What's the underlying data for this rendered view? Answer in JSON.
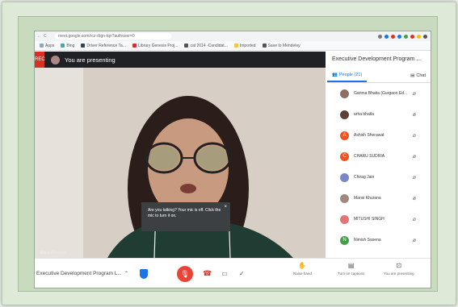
{
  "browser": {
    "url": "meet.google.com/rcz-rbgn-tqn?authuser=0",
    "bookmarks": [
      {
        "label": "Apps"
      },
      {
        "label": "Bing"
      },
      {
        "label": "Driver Reference Ta..."
      },
      {
        "label": "Library Genesis Proj..."
      },
      {
        "label": "cat 2014 -Candidat..."
      },
      {
        "label": "Imported"
      },
      {
        "label": "Save to Mendeley"
      }
    ]
  },
  "meet": {
    "rec_label": "REC",
    "presenting_text": "You are presenting",
    "speaker_name": "Manu Khurana",
    "tooltip_text": "Are you talking? Your mic is off. Click the mic to turn it on.",
    "panel_title": "Executive Development Program ...",
    "people_tab": "People (21)",
    "chat_tab": "Chat",
    "participants": [
      {
        "name": "Garima Bhatia (Gurgaon Ed...",
        "color": "#8d6e63",
        "initial": ""
      },
      {
        "name": "arha bhatla",
        "color": "#5d4037",
        "initial": ""
      },
      {
        "name": "Ashish Sherawat",
        "color": "#f4511e",
        "initial": "A"
      },
      {
        "name": "CHARU SUDRIA",
        "color": "#f4511e",
        "initial": "C"
      },
      {
        "name": "Chirag Jain",
        "color": "#7986cb",
        "initial": ""
      },
      {
        "name": "Mansi Khurana",
        "color": "#a1887f",
        "initial": ""
      },
      {
        "name": "MITUSHI SINGH",
        "color": "#e57373",
        "initial": ""
      },
      {
        "name": "Nimish Saxena",
        "color": "#43a047",
        "initial": "N"
      }
    ],
    "meeting_name": "Executive Development Program L...",
    "actions": {
      "raise_hand": "Raise hand",
      "turn_on_captions": "Turn on captions",
      "you_are_presenting": "You are presenting"
    }
  },
  "colors": {
    "accent": "#1a73e8",
    "mic_off": "#ea4335",
    "frame": "#dfe9d7"
  }
}
